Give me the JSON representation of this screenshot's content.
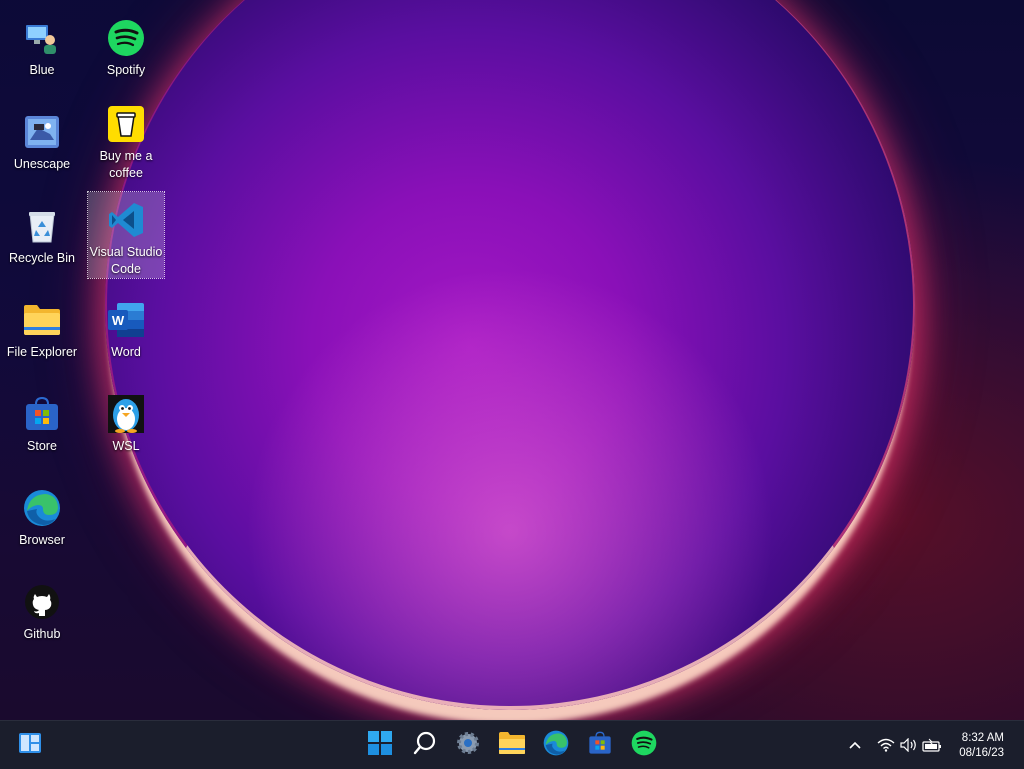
{
  "desktop": {
    "icons": [
      {
        "label": "Blue",
        "icon": "user-monitor-icon"
      },
      {
        "label": "Unescape",
        "icon": "unescape-game-icon"
      },
      {
        "label": "Recycle Bin",
        "icon": "recycle-bin-icon"
      },
      {
        "label": "File Explorer",
        "icon": "folder-icon"
      },
      {
        "label": "Store",
        "icon": "store-bag-icon"
      },
      {
        "label": "Browser",
        "icon": "edge-browser-icon"
      },
      {
        "label": "Github",
        "icon": "github-icon"
      },
      {
        "label": "Spotify",
        "icon": "spotify-icon"
      },
      {
        "label": "Buy me a coffee",
        "icon": "coffee-cup-icon"
      },
      {
        "label": "Visual Studio Code",
        "icon": "vscode-icon",
        "selected": true
      },
      {
        "label": "Word",
        "icon": "word-icon"
      },
      {
        "label": "WSL",
        "icon": "linux-penguin-icon"
      }
    ]
  },
  "taskbar": {
    "widgets_icon": "widgets-icon",
    "pinned": [
      "windows-start-icon",
      "search-icon",
      "settings-gear-icon",
      "file-explorer-icon",
      "edge-browser-icon",
      "store-bag-icon",
      "spotify-icon"
    ],
    "tray": [
      "chevron-up-icon",
      "wifi-icon",
      "volume-icon",
      "battery-icon"
    ],
    "time": "8:32 AM",
    "date": "08/16/23"
  },
  "colors": {
    "accent": "#1e8fe0",
    "spotify": "#1ed760",
    "taskbar": "#1b1e2c"
  }
}
